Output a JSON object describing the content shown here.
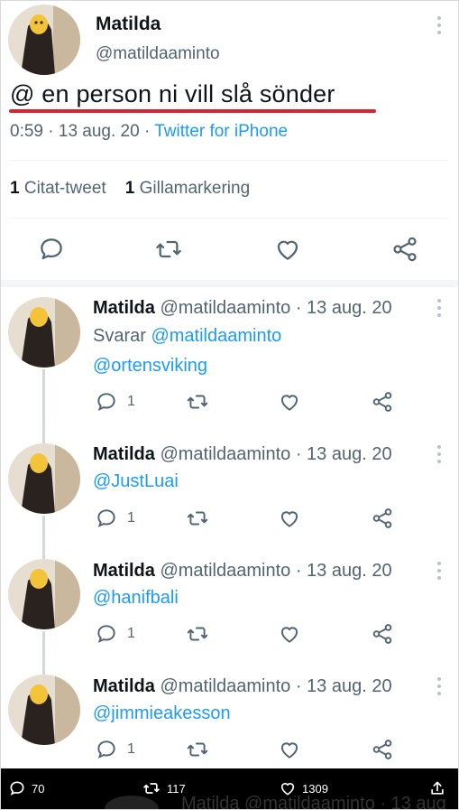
{
  "main_tweet": {
    "name": "Matilda",
    "handle": "@matildaaminto",
    "text": "@ en person ni vill slå sönder",
    "time": "0:59",
    "date": "13 aug. 20",
    "source": "Twitter for iPhone",
    "quote_count": "1",
    "quote_label": "Citat-tweet",
    "like_count": "1",
    "like_label": "Gillamarkering",
    "icons": [
      "reply-icon",
      "retweet-icon",
      "like-icon",
      "share-icon"
    ],
    "underline_color": "#d42630"
  },
  "replies": [
    {
      "name": "Matilda",
      "handle_date": "@matildaaminto · 13 aug. 20",
      "reply_prefix": "Svarar",
      "reply_to": "@matildaaminto",
      "text": "@ortensviking",
      "reply_count": "1"
    },
    {
      "name": "Matilda",
      "handle_date": "@matildaaminto · 13 aug. 20",
      "text": "@JustLuai",
      "reply_count": "1"
    },
    {
      "name": "Matilda",
      "handle_date": "@matildaaminto · 13 aug. 20",
      "text": "@hanifbali",
      "reply_count": "1"
    },
    {
      "name": "Matilda",
      "handle_date": "@matildaaminto · 13 aug. 20",
      "text": "@jimmieakesson",
      "reply_count": "1"
    }
  ],
  "bottom_bar": {
    "replies": "70",
    "retweets": "117",
    "likes": "1309",
    "behind_text": "Matilda @matildaaminto · 13 aug"
  },
  "colors": {
    "link": "#1d9bf0",
    "muted": "#536471",
    "text": "#0f1419"
  }
}
